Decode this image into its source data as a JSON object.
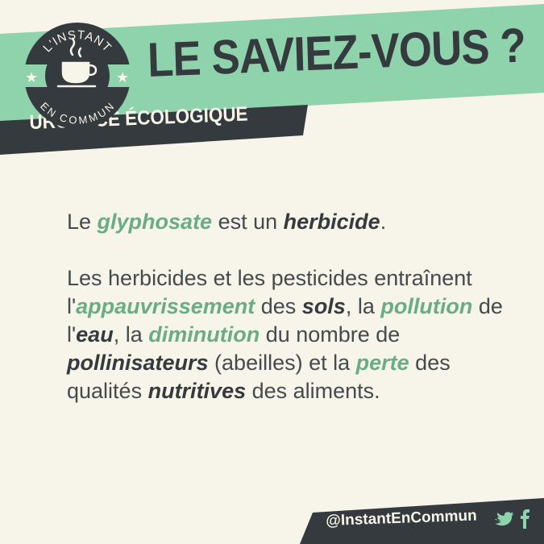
{
  "header": {
    "title": "LE SAVIEZ-VOUS ?",
    "category": "URGENCE ÉCOLOGIQUE"
  },
  "logo": {
    "top_text": "L'INSTANT",
    "bottom_text": "EN COMMUN",
    "icon": "coffee-cup-icon"
  },
  "content": {
    "p1": {
      "s1": "Le ",
      "k1": "glyphosate",
      "s2": " est un ",
      "k2": "herbicide",
      "s3": "."
    },
    "p2": {
      "s1": "Les herbicides et les pesticides entraînent l'",
      "k1": "appauvrissement",
      "s2": " des ",
      "k2": "sols",
      "s3": ", la ",
      "k3": "pollution",
      "s4": " de l'",
      "k4": "eau",
      "s5": ", la ",
      "k5": "diminution",
      "s6": " du nombre de ",
      "k6": "pollinisateurs",
      "s7": " (abeilles) et la ",
      "k7": "perte",
      "s8": " des qualités ",
      "k8": "nutritives",
      "s9": " des aliments."
    }
  },
  "footer": {
    "handle": "@InstantEnCommun",
    "icons": [
      "twitter-icon",
      "facebook-icon"
    ]
  },
  "colors": {
    "background": "#f7f4ea",
    "accent_green": "#8fd3ad",
    "keyword_green": "#6aad85",
    "dark": "#343a3d"
  }
}
